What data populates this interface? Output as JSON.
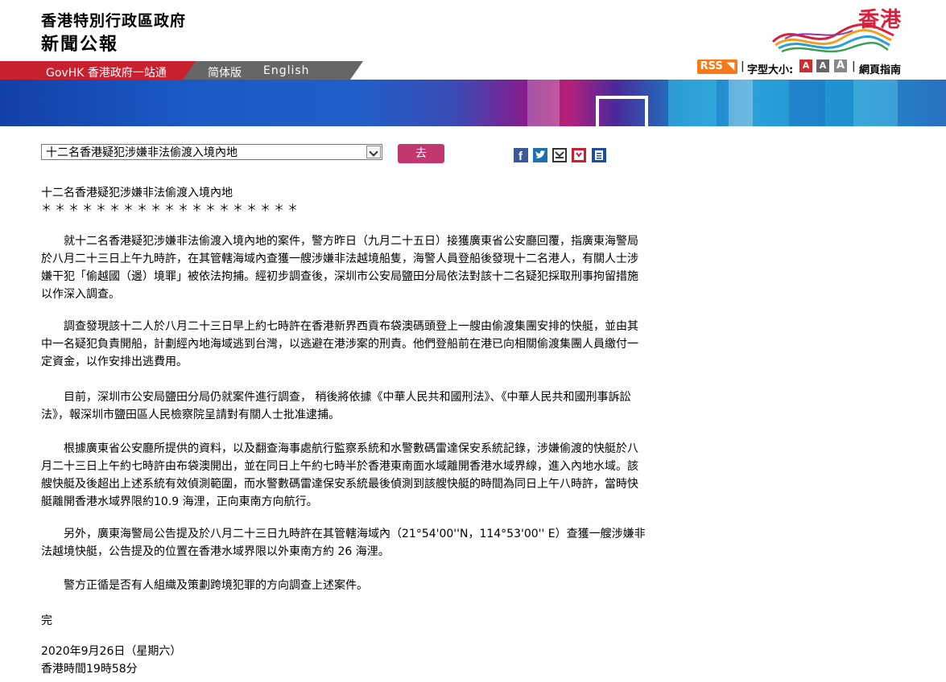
{
  "header": {
    "gov_name": "香港特別行政區政府",
    "section_name": "新聞公報",
    "brand": "香港"
  },
  "nav": {
    "govhk": "GovHK 香港政府一站通",
    "simplified": "简体版",
    "english": "English"
  },
  "tools": {
    "rss": "RSS",
    "font_size_label": "字型大小:",
    "font_sizes": [
      "A",
      "A",
      "A"
    ],
    "site_guide": "網頁指南"
  },
  "colors": {
    "accent_red": "#c8202f",
    "go_button": "#c2376d",
    "rss_orange": "#f47a1a"
  },
  "selector": {
    "selected": "十二名香港疑犯涉嫌非法偷渡入境內地",
    "go_label": "去"
  },
  "share_icons": [
    "facebook-icon",
    "twitter-icon",
    "email-icon",
    "bookmark-icon",
    "print-icon"
  ],
  "article": {
    "title": "十二名香港疑犯涉嫌非法偷渡入境內地",
    "separator": "＊＊＊＊＊＊＊＊＊＊＊＊＊＊＊＊＊＊＊",
    "paragraphs": [
      "就十二名香港疑犯涉嫌非法偷渡入境內地的案件，警方昨日（九月二十五日）接獲廣東省公安廳回覆，指廣東海警局於八月二十三日上午九時許，在其管轄海域內查獲一艘涉嫌非法越境船隻，海警人員登船後發現十二名港人，有關人士涉嫌干犯「偷越國（邊）境罪」被依法拘捕。經初步調查後，深圳市公安局鹽田分局依法對該十二名疑犯採取刑事拘留措施以作深入調查。",
      "調查發現該十二人於八月二十三日早上約七時許在香港新界西貢布袋澳碼頭登上一艘由偷渡集團安排的快艇，並由其中一名疑犯負責開船，計劃經內地海域逃到台灣，以逃避在港涉案的刑責。他們登船前在港已向相關偷渡集團人員繳付一定資金，以作安排出逃費用。",
      "目前，深圳市公安局鹽田分局仍就案件進行調查， 稍後將依據《中華人民共和國刑法》、《中華人民共和國刑事訴訟法》，報深圳市鹽田區人民檢察院呈請對有關人士批准逮捕。",
      "根據廣東省公安廳所提供的資料，以及翻查海事處航行監察系統和水警數碼雷達保安系統記錄，涉嫌偷渡的快艇於八月二十三日上午約七時許由布袋澳開出，並在同日上午約七時半於香港東南面水域離開香港水域界線，進入內地水域。該艘快艇及後超出上述系統有效偵測範圍，而水警數碼雷達保安系統最後偵測到該艘快艇的時間為同日上午八時許，當時快艇離開香港水域界限約10.9 海浬，正向東南方向航行。",
      "另外，廣東海警局公告提及於八月二十三日九時許在其管轄海域內（21°54'00''N，114°53'00'' E）查獲一艘涉嫌非法越境快艇，公告提及的位置在香港水域界限以外東南方約 26 海浬。",
      "警方正循是否有人組織及策劃跨境犯罪的方向調查上述案件。"
    ],
    "end_mark": "完",
    "date": "2020年9月26日（星期六）",
    "time": "香港時間19時58分"
  }
}
